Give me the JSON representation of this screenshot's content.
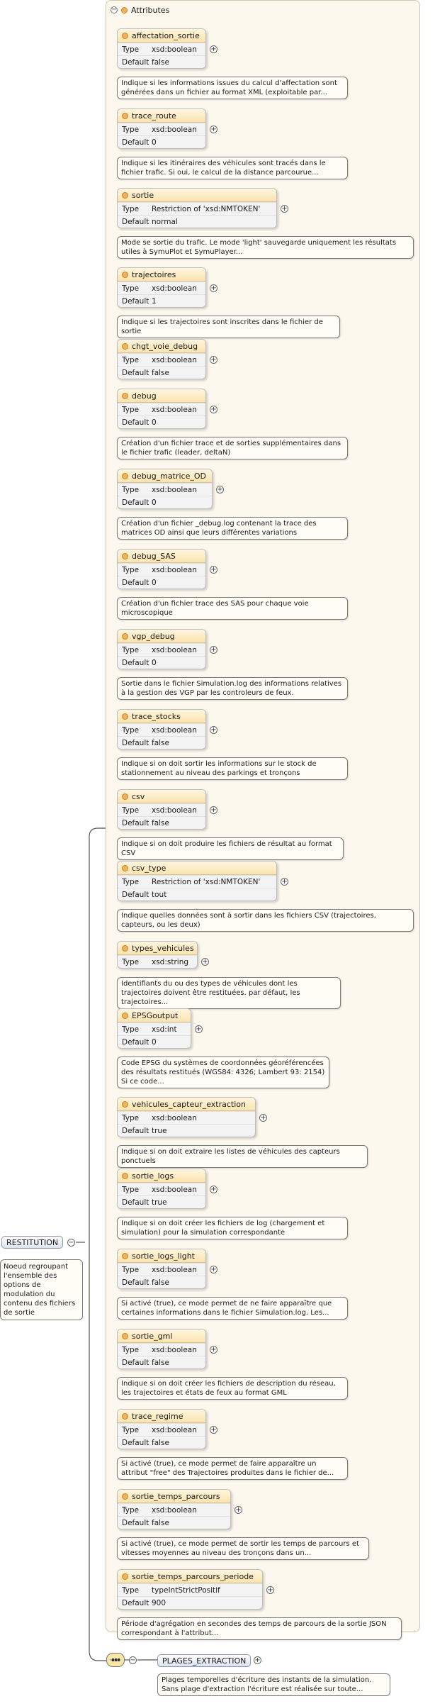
{
  "panel": {
    "title": "Attributes"
  },
  "root": {
    "label": "RESTITUTION",
    "note": "Noeud regroupant l'ensemble des options de modulation du contenu des fichiers de sortie"
  },
  "type_key": "Type",
  "default_key": "Default",
  "attributes": [
    {
      "name": "affectation_sortie",
      "type": "xsd:boolean",
      "default": "false",
      "note": "Indique si les informations issues du calcul d'affectation sont générées dans un fichier au format XML (exploitable par..."
    },
    {
      "name": "trace_route",
      "type": "xsd:boolean",
      "default": "0",
      "note": "Indique si les itinéraires des véhicules sont tracés dans le fichier trafic. Si oui, le calcul de la distance parcourue..."
    },
    {
      "name": "sortie",
      "type": "Restriction of 'xsd:NMTOKEN'",
      "default": "normal",
      "note": "Mode se sortie du trafic. Le mode 'light' sauvegarde uniquement les résultats utiles à SymuPlot et SymuPlayer..."
    },
    {
      "name": "trajectoires",
      "type": "xsd:boolean",
      "default": "1",
      "note": "Indique si les trajectoires sont inscrites dans le fichier de sortie"
    },
    {
      "name": "chgt_voie_debug",
      "type": "xsd:boolean",
      "default": "false",
      "note": ""
    },
    {
      "name": "debug",
      "type": "xsd:boolean",
      "default": "0",
      "note": "Création d'un fichier trace et de sorties supplémentaires dans le fichier trafic (leader, deltaN)"
    },
    {
      "name": "debug_matrice_OD",
      "type": "xsd:boolean",
      "default": "0",
      "note": "Création d'un fichier _debug.log contenant la trace des matrices OD ainsi que leurs différentes variations"
    },
    {
      "name": "debug_SAS",
      "type": "xsd:boolean",
      "default": "0",
      "note": "Création d'un fichier trace des SAS pour chaque voie microscopique"
    },
    {
      "name": "vgp_debug",
      "type": "xsd:boolean",
      "default": "0",
      "note": "Sortie dans le fichier Simulation.log des informations relatives à la gestion des VGP par les controleurs de feux."
    },
    {
      "name": "trace_stocks",
      "type": "xsd:boolean",
      "default": "false",
      "note": "Indique si on doit sortir les informations sur le stock de stationnement au niveau des parkings et tronçons"
    },
    {
      "name": "csv",
      "type": "xsd:boolean",
      "default": "false",
      "note": "Indique si on doit produire les fichiers de résultat au format CSV"
    },
    {
      "name": "csv_type",
      "type": "Restriction of 'xsd:NMTOKEN'",
      "default": "tout",
      "note": "Indique quelles données sont à sortir dans les fichiers CSV (trajectoires, capteurs, ou les deux)"
    },
    {
      "name": "types_vehicules",
      "type": "xsd:string",
      "default": null,
      "note": "Identifiants du ou des types de véhicules dont les trajectoires doivent être restituées. par défaut, les trajectoires..."
    },
    {
      "name": "EPSGoutput",
      "type": "xsd:int",
      "default": "0",
      "note": "Code EPSG du systèmes de coordonnées géoréférencées des résultats restitués (WGS84: 4326; Lambert 93: 2154) Si ce code..."
    },
    {
      "name": "vehicules_capteur_extraction",
      "type": "xsd:boolean",
      "default": "true",
      "note": "Indique si on doit extraire les listes de véhicules des capteurs ponctuels"
    },
    {
      "name": "sortie_logs",
      "type": "xsd:boolean",
      "default": "true",
      "note": "Indique si on doit créer les fichiers de log (chargement et simulation) pour la simulation correspondante"
    },
    {
      "name": "sortie_logs_light",
      "type": "xsd:boolean",
      "default": "false",
      "note": "Si activé (true), ce mode permet de ne faire apparaître que certaines informations dans le fichier Simulation.log. Les..."
    },
    {
      "name": "sortie_gml",
      "type": "xsd:boolean",
      "default": "false",
      "note": "Indique si on doit créer les fichiers de description du réseau, les trajectoires et états de feux au format GML"
    },
    {
      "name": "trace_regime",
      "type": "xsd:boolean",
      "default": "false",
      "note": "Si activé (true), ce mode permet de faire apparaître un attribut \"free\" des Trajectoires produites dans le fichier de..."
    },
    {
      "name": "sortie_temps_parcours",
      "type": "xsd:boolean",
      "default": "false",
      "note": "Si activé (true), ce mode permet de sortir les temps de parcours et vitesses moyennes au niveau des tronçons dans un..."
    },
    {
      "name": "sortie_temps_parcours_periode",
      "type": "typeIntStrictPositif",
      "default": "900",
      "note": "Période d'agrégation en secondes des temps de parcours de la sortie JSON correspondant à l'attribut..."
    }
  ],
  "plages": {
    "label": "PLAGES_EXTRACTION",
    "note": "Plages temporelles d'écriture des instants de la simulation. Sans plage d'extraction l'écriture est réalisée sur toute..."
  }
}
